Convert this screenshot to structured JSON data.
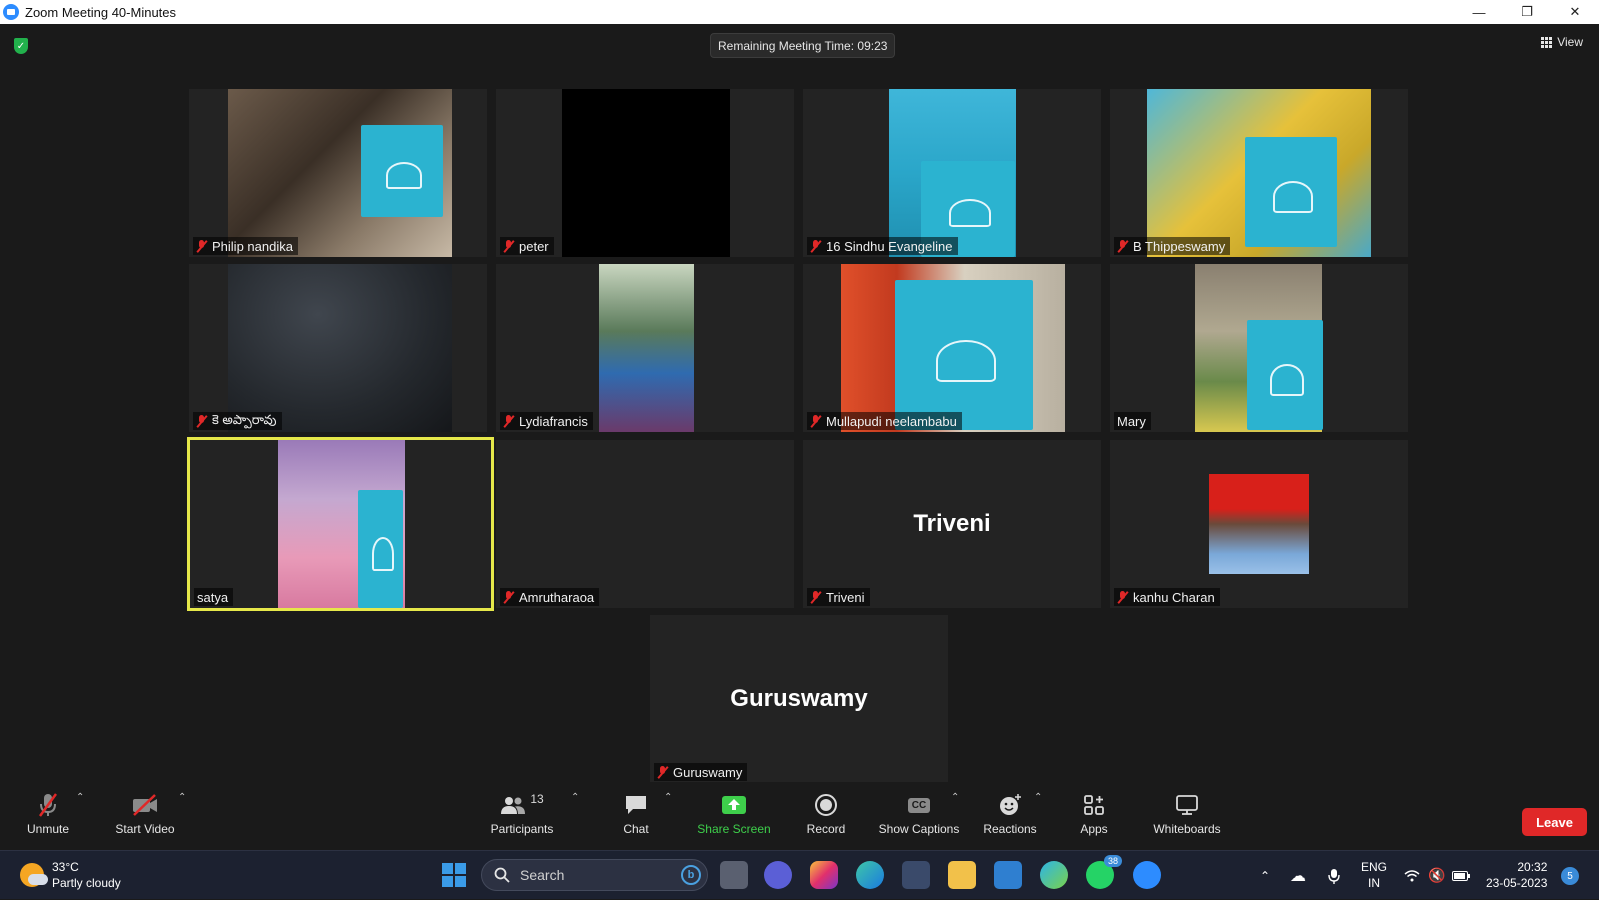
{
  "window": {
    "title": "Zoom Meeting 40-Minutes"
  },
  "meeting": {
    "remaining_time": "Remaining Meeting Time: 09:23",
    "view_label": "View"
  },
  "participants": [
    {
      "name": "Philip nandika",
      "muted": true
    },
    {
      "name": "peter",
      "muted": true
    },
    {
      "name": "16 Sindhu Evangeline",
      "muted": true
    },
    {
      "name": "B Thippeswamy",
      "muted": true
    },
    {
      "name": "కె అప్పారావు",
      "muted": true
    },
    {
      "name": "Lydiafrancis",
      "muted": true
    },
    {
      "name": "Mullapudi neelambabu",
      "muted": true
    },
    {
      "name": "Mary",
      "muted": false
    },
    {
      "name": "satya",
      "muted": false,
      "active_speaker": true
    },
    {
      "name": "Amrutharaoa",
      "muted": true
    },
    {
      "name": "Triveni",
      "muted": true,
      "display_big": "Triveni"
    },
    {
      "name": "kanhu Charan",
      "muted": true
    },
    {
      "name": "Guruswamy",
      "muted": true,
      "display_big": "Guruswamy"
    }
  ],
  "toolbar": {
    "unmute": "Unmute",
    "start_video": "Start Video",
    "participants": "Participants",
    "participants_count": "13",
    "chat": "Chat",
    "share_screen": "Share Screen",
    "record": "Record",
    "show_captions": "Show Captions",
    "cc_badge": "CC",
    "reactions": "Reactions",
    "apps": "Apps",
    "whiteboards": "Whiteboards",
    "leave": "Leave"
  },
  "taskbar": {
    "weather_temp": "33°C",
    "weather_desc": "Partly cloudy",
    "search_placeholder": "Search",
    "whatsapp_badge": "38",
    "lang_top": "ENG",
    "lang_bottom": "IN",
    "time": "20:32",
    "date": "23-05-2023",
    "notification_count": "5"
  },
  "colors": {
    "leave": "#e02828",
    "share_green": "#3ecf4b",
    "active_border": "#e6e84a",
    "mute_red": "#e02828"
  }
}
